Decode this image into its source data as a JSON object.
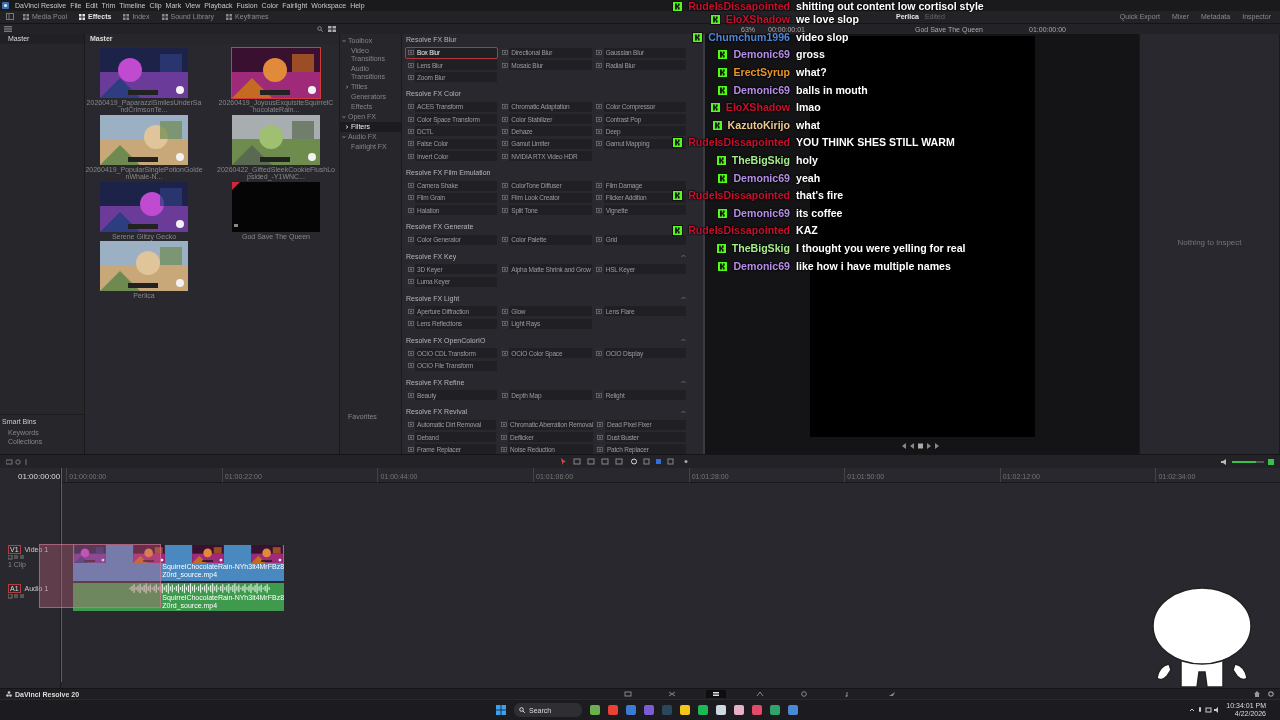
{
  "menu": [
    "DaVinci Resolve",
    "File",
    "Edit",
    "Trim",
    "Timeline",
    "Clip",
    "Mark",
    "View",
    "Playback",
    "Fusion",
    "Color",
    "Fairlight",
    "Workspace",
    "Help"
  ],
  "toolbar": {
    "left": [
      {
        "label": "Media Pool",
        "selected": false
      },
      {
        "label": "Effects",
        "selected": true
      },
      {
        "label": "Index",
        "selected": false
      },
      {
        "label": "Sound Library",
        "selected": false
      },
      {
        "label": "Keyframes",
        "selected": false
      }
    ],
    "project": "Perlica",
    "project_state": "Edited",
    "right": [
      "Quick Export",
      "Mixer",
      "Metadata",
      "Inspector"
    ]
  },
  "bins": {
    "title": "Master",
    "smart_bins": "Smart Bins",
    "items": [
      "Keywords",
      "Collections"
    ]
  },
  "media_pool": {
    "title": "Master",
    "clips": [
      {
        "name": "20260419_PaparazziSmilesUnderSandCrimsonTe...",
        "kind": "picture",
        "selected": false
      },
      {
        "name": "20260419_JoyousExquisiteSquirrelChocolateRain...",
        "kind": "picture",
        "selected": true
      },
      {
        "name": "20260419_PopularSinglePotionGoldenWhale-N...",
        "kind": "picture",
        "selected": false
      },
      {
        "name": "20260422_GiftedSleekCookieFlushLopsided_-Y1WNC...",
        "kind": "picture",
        "selected": false
      },
      {
        "name": "Serene Glitzy Gecko",
        "kind": "picture",
        "selected": false
      },
      {
        "name": "God Save The Queen",
        "kind": "black",
        "selected": false
      },
      {
        "name": "Perlica",
        "kind": "picture",
        "selected": false
      }
    ]
  },
  "fx_tree": {
    "items": [
      {
        "label": "Toolbox",
        "expanded": true,
        "selected": false,
        "children": [
          {
            "label": "Video Transitions",
            "selected": false
          },
          {
            "label": "Audio Transitions",
            "selected": false
          },
          {
            "label": "Titles",
            "expanded": false,
            "selected": false
          },
          {
            "label": "Generators",
            "selected": false
          },
          {
            "label": "Effects",
            "selected": false
          }
        ]
      },
      {
        "label": "Open FX",
        "expanded": true,
        "selected": false,
        "children": [
          {
            "label": "Filters",
            "expanded": false,
            "selected": true
          }
        ]
      },
      {
        "label": "Audio FX",
        "expanded": true,
        "selected": false,
        "children": [
          {
            "label": "Fairlight FX",
            "selected": false
          }
        ]
      }
    ],
    "favorites": "Favorites"
  },
  "fx_sections": [
    {
      "title": "Resolve FX Blur",
      "items": [
        {
          "label": "Box Blur",
          "selected": true
        },
        {
          "label": "Directional Blur",
          "selected": false
        },
        {
          "label": "Gaussian Blur",
          "selected": false
        },
        {
          "label": "Lens Blur",
          "selected": false
        },
        {
          "label": "Mosaic Blur",
          "selected": false
        },
        {
          "label": "Radial Blur",
          "selected": false
        },
        {
          "label": "Zoom Blur",
          "selected": false
        }
      ]
    },
    {
      "title": "Resolve FX Color",
      "items": [
        {
          "label": "ACES Transform",
          "selected": false
        },
        {
          "label": "Chromatic Adaptation",
          "selected": false
        },
        {
          "label": "Color Compressor",
          "selected": false
        },
        {
          "label": "Color Space Transform",
          "selected": false
        },
        {
          "label": "Color Stabilizer",
          "selected": false
        },
        {
          "label": "Contrast Pop",
          "selected": false
        },
        {
          "label": "DCTL",
          "selected": false
        },
        {
          "label": "Dehaze",
          "selected": false
        },
        {
          "label": "Deep",
          "selected": false
        },
        {
          "label": "False Color",
          "selected": false
        },
        {
          "label": "Gamut Limiter",
          "selected": false
        },
        {
          "label": "Gamut Mapping",
          "selected": false
        },
        {
          "label": "Invert Color",
          "selected": false
        },
        {
          "label": "NVIDIA RTX Video HDR",
          "selected": false
        }
      ]
    },
    {
      "title": "Resolve FX Film Emulation",
      "items": [
        {
          "label": "Camera Shake",
          "selected": false
        },
        {
          "label": "ColorTone Diffuser",
          "selected": false
        },
        {
          "label": "Film Damage",
          "selected": false
        },
        {
          "label": "Film Grain",
          "selected": false
        },
        {
          "label": "Film Look Creator",
          "selected": false
        },
        {
          "label": "Flicker Addition",
          "selected": false
        },
        {
          "label": "Halation",
          "selected": false
        },
        {
          "label": "Split Tone",
          "selected": false
        },
        {
          "label": "Vignette",
          "selected": false
        }
      ]
    },
    {
      "title": "Resolve FX Generate",
      "items": [
        {
          "label": "Color Generator",
          "selected": false
        },
        {
          "label": "Color Palette",
          "selected": false
        },
        {
          "label": "Grid",
          "selected": false
        }
      ]
    },
    {
      "title": "Resolve FX Key",
      "items": [
        {
          "label": "3D Keyer",
          "selected": false
        },
        {
          "label": "Alpha Matte Shrink and Grow",
          "selected": false
        },
        {
          "label": "HSL Keyer",
          "selected": false
        },
        {
          "label": "Luma Keyer",
          "selected": false
        }
      ]
    },
    {
      "title": "Resolve FX Light",
      "items": [
        {
          "label": "Aperture Diffraction",
          "selected": false
        },
        {
          "label": "Glow",
          "selected": false
        },
        {
          "label": "Lens Flare",
          "selected": false
        },
        {
          "label": "Lens Reflections",
          "selected": false
        },
        {
          "label": "Light Rays",
          "selected": false
        }
      ]
    },
    {
      "title": "Resolve FX OpenColorIO",
      "items": [
        {
          "label": "OCIO CDL Transform",
          "selected": false
        },
        {
          "label": "OCIO Color Space",
          "selected": false
        },
        {
          "label": "OCIO Display",
          "selected": false
        },
        {
          "label": "OCIO File Transform",
          "selected": false
        }
      ]
    },
    {
      "title": "Resolve FX Refine",
      "items": [
        {
          "label": "Beauty",
          "selected": false
        },
        {
          "label": "Depth Map",
          "selected": false
        },
        {
          "label": "Relight",
          "selected": false
        }
      ]
    },
    {
      "title": "Resolve FX Revival",
      "items": [
        {
          "label": "Automatic Dirt Removal",
          "selected": false
        },
        {
          "label": "Chromatic Aberration Removal",
          "selected": false
        },
        {
          "label": "Dead Pixel Fixer",
          "selected": false
        },
        {
          "label": "Deband",
          "selected": false
        },
        {
          "label": "Deflicker",
          "selected": false
        },
        {
          "label": "Dust Buster",
          "selected": false
        },
        {
          "label": "Frame Replacer",
          "selected": false
        },
        {
          "label": "Noise Reduction",
          "selected": false
        },
        {
          "label": "Patch Replacer",
          "selected": false
        }
      ]
    }
  ],
  "viewer": {
    "zoom": "63%",
    "timecode": "00:00:00:01",
    "title": "God Save The Queen",
    "record_timecode": "01:00:00:00"
  },
  "inspector": {
    "empty_text": "Nothing to inspect"
  },
  "timeline": {
    "timecode": "01:00:00:00",
    "ruler": [
      "01:00:00:00",
      "01:00:22:00",
      "01:00:44:00",
      "01:01:06:00",
      "01:01:28:00",
      "01:01:50:00",
      "01:02:12:00",
      "01:02:34:00"
    ],
    "tracks": [
      {
        "kind": "video",
        "id": "V1",
        "name": "Video 1",
        "info": "1 Clip",
        "clip_label": "SquirrelChocolateRain-NYh3lt4MrFBz8Z0rd_source.mp4"
      },
      {
        "kind": "audio",
        "id": "A1",
        "name": "Audio 1",
        "clip_label": "SquirrelChocolateRain-NYh3lt4MrFBz8Z0rd_source.mp4"
      }
    ],
    "volume": {
      "level": 0.75
    }
  },
  "pages": [
    {
      "kind": "media",
      "selected": false
    },
    {
      "kind": "cut",
      "selected": false
    },
    {
      "kind": "edit",
      "selected": true
    },
    {
      "kind": "fusion",
      "selected": false
    },
    {
      "kind": "color",
      "selected": false
    },
    {
      "kind": "fairlight",
      "selected": false
    },
    {
      "kind": "deliver",
      "selected": false
    }
  ],
  "app_name": "DaVinci Resolve 20",
  "taskbar": {
    "search": "Search",
    "time": "10:34:01 PM",
    "date": "4/22/2026"
  },
  "chat": [
    {
      "user": "RudeIsDissapointed",
      "color": "#c8102e",
      "message": "shitting out content low cortisol style"
    },
    {
      "user": "EloXShadow",
      "color": "#c8102e",
      "message": "we love slop"
    },
    {
      "user": "Chumchum1996",
      "color": "#4f86d9",
      "message": "video slop"
    },
    {
      "user": "Demonic69",
      "color": "#b48ee6",
      "message": "gross"
    },
    {
      "user": "ErectSyrup",
      "color": "#e8962a",
      "message": "what?"
    },
    {
      "user": "Demonic69",
      "color": "#b48ee6",
      "message": "balls in mouth"
    },
    {
      "user": "EloXShadow",
      "color": "#c8102e",
      "message": "lmao"
    },
    {
      "user": "KazutoKirijo",
      "color": "#ecc98e",
      "message": "what"
    },
    {
      "user": "RudeIsDissapointed",
      "color": "#c8102e",
      "message": "YOU THINK SHES STILL WARM"
    },
    {
      "user": "TheBigSkig",
      "color": "#a6ec8c",
      "message": "holy"
    },
    {
      "user": "Demonic69",
      "color": "#b48ee6",
      "message": "yeah"
    },
    {
      "user": "RudeIsDissapointed",
      "color": "#c8102e",
      "message": "that's fire"
    },
    {
      "user": "Demonic69",
      "color": "#b48ee6",
      "message": "its coffee"
    },
    {
      "user": "RudeIsDissapointed",
      "color": "#c8102e",
      "message": "KAZ"
    },
    {
      "user": "TheBigSkig",
      "color": "#a6ec8c",
      "message": "I thought you were yelling for real"
    },
    {
      "user": "Demonic69",
      "color": "#b48ee6",
      "message": "like how i have multiple names"
    }
  ]
}
